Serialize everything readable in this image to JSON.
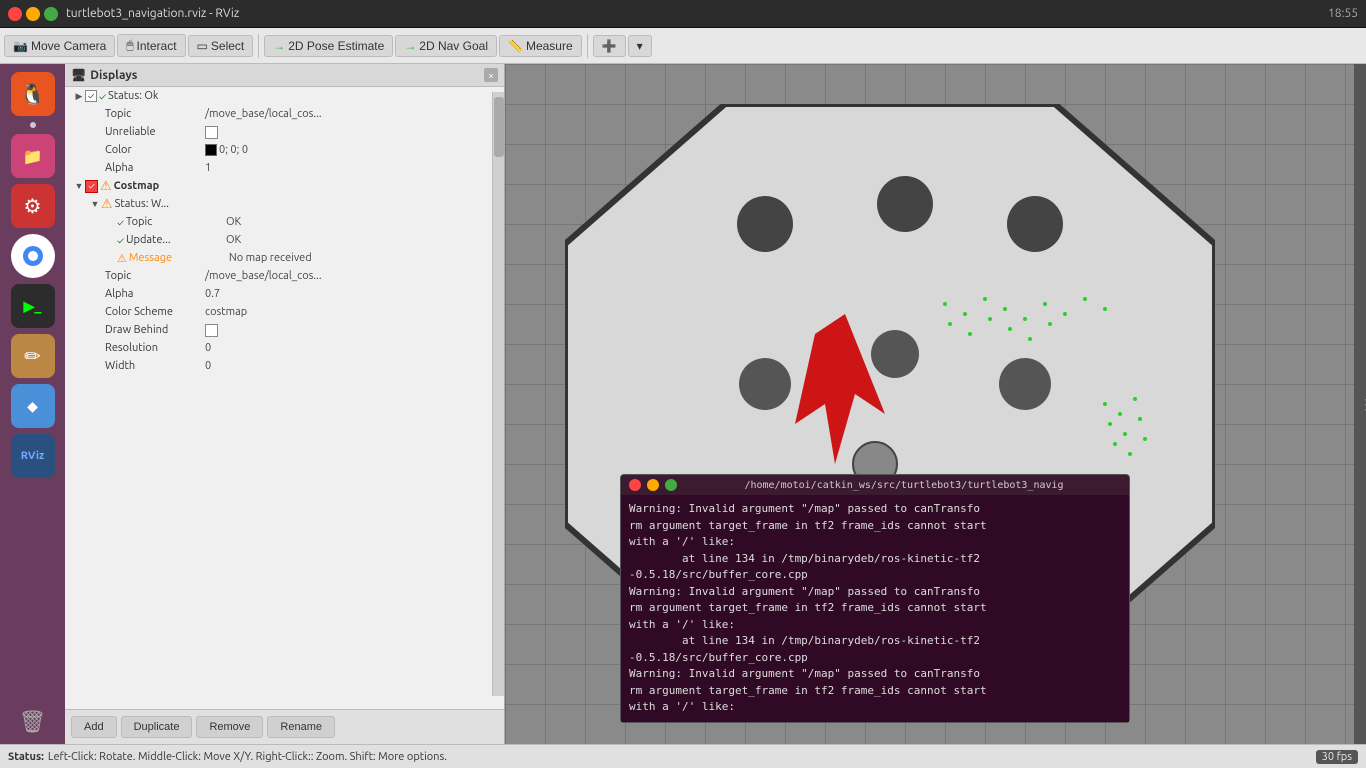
{
  "titleBar": {
    "title": "turtlebot3_navigation.rviz - RViz",
    "closeBtn": "×",
    "minBtn": "−",
    "maxBtn": "□"
  },
  "toolbar": {
    "moveCamera": "Move Camera",
    "interact": "Interact",
    "select": "Select",
    "poseEstimate": "2D Pose Estimate",
    "navGoal": "2D Nav Goal",
    "measure": "Measure"
  },
  "displaysPanel": {
    "title": "Displays",
    "items": [
      {
        "level": 0,
        "arrow": "▶",
        "check": true,
        "statusIcon": "✓",
        "statusClass": "status-ok",
        "key": "Status: Ok",
        "val": ""
      },
      {
        "level": 1,
        "key": "Topic",
        "val": "/move_base/local_cos..."
      },
      {
        "level": 1,
        "key": "Unreliable",
        "val": "",
        "checkbox": true,
        "checked": false
      },
      {
        "level": 1,
        "key": "Color",
        "val": "0; 0; 0",
        "swatch": "#000"
      },
      {
        "level": 1,
        "key": "Alpha",
        "val": "1"
      },
      {
        "level": 0,
        "arrow": "▼",
        "check": true,
        "statusIcon": "!",
        "statusClass": "status-warn",
        "key": "Costmap",
        "val": "",
        "orangeCheck": true
      },
      {
        "level": 1,
        "arrow": "▼",
        "statusIcon": "!",
        "statusClass": "status-warn",
        "key": "Status: W..."
      },
      {
        "level": 2,
        "statusIcon": "✓",
        "statusClass": "status-ok",
        "key": "Topic",
        "val": "OK"
      },
      {
        "level": 2,
        "statusIcon": "✓",
        "statusClass": "status-ok",
        "key": "Update...",
        "val": "OK"
      },
      {
        "level": 2,
        "statusIcon": "!",
        "statusClass": "status-warn",
        "key": "Message",
        "val": "No map received"
      },
      {
        "level": 1,
        "key": "Topic",
        "val": "/move_base/local_cos..."
      },
      {
        "level": 1,
        "key": "Alpha",
        "val": "0.7"
      },
      {
        "level": 1,
        "key": "Color Scheme",
        "val": "costmap"
      },
      {
        "level": 1,
        "key": "Draw Behind",
        "val": "",
        "checkbox": true,
        "checked": false
      },
      {
        "level": 1,
        "key": "Resolution",
        "val": "0"
      },
      {
        "level": 1,
        "key": "Width",
        "val": "0"
      }
    ],
    "buttons": [
      "Add",
      "Duplicate",
      "Remove",
      "Rename"
    ]
  },
  "terminal": {
    "title": "/home/motoi/catkin_ws/src/turtlebot3/turtlebot3_navig",
    "lines": [
      "Warning: Invalid argument \"/map\" passed to canTransfo",
      "rm argument target_frame in tf2 frame_ids cannot start",
      "with a '/' like:",
      "        at line 134 in /tmp/binarydeb/ros-kinetic-tf2",
      "-0.5.18/src/buffer_core.cpp",
      "Warning: Invalid argument \"/map\" passed to canTransfo",
      "rm argument target_frame in tf2 frame_ids cannot start",
      "with a '/' like:",
      "        at line 134 in /tmp/binarydeb/ros-kinetic-tf2",
      "-0.5.18/src/buffer_core.cpp",
      "Warning: Invalid argument \"/map\" passed to canTransfo",
      "rm argument target_frame in tf2 frame_ids cannot start",
      "with a '/' like:"
    ]
  },
  "statusBar": {
    "statusLabel": "Status:",
    "hint": "Left-Click: Rotate. Middle-Click: Move X/Y. Right-Click:: Zoom. Shift: More options.",
    "fps": "30 fps"
  },
  "sidebar": {
    "icons": [
      "🐧",
      "📁",
      "⚙",
      "🌐",
      ">_",
      "✏",
      "◆",
      "RV",
      "🗑"
    ],
    "names": [
      "ubuntu",
      "files",
      "settings",
      "chrome",
      "terminal",
      "editor",
      "stack",
      "rviz",
      "trash"
    ]
  },
  "time": "18:55"
}
